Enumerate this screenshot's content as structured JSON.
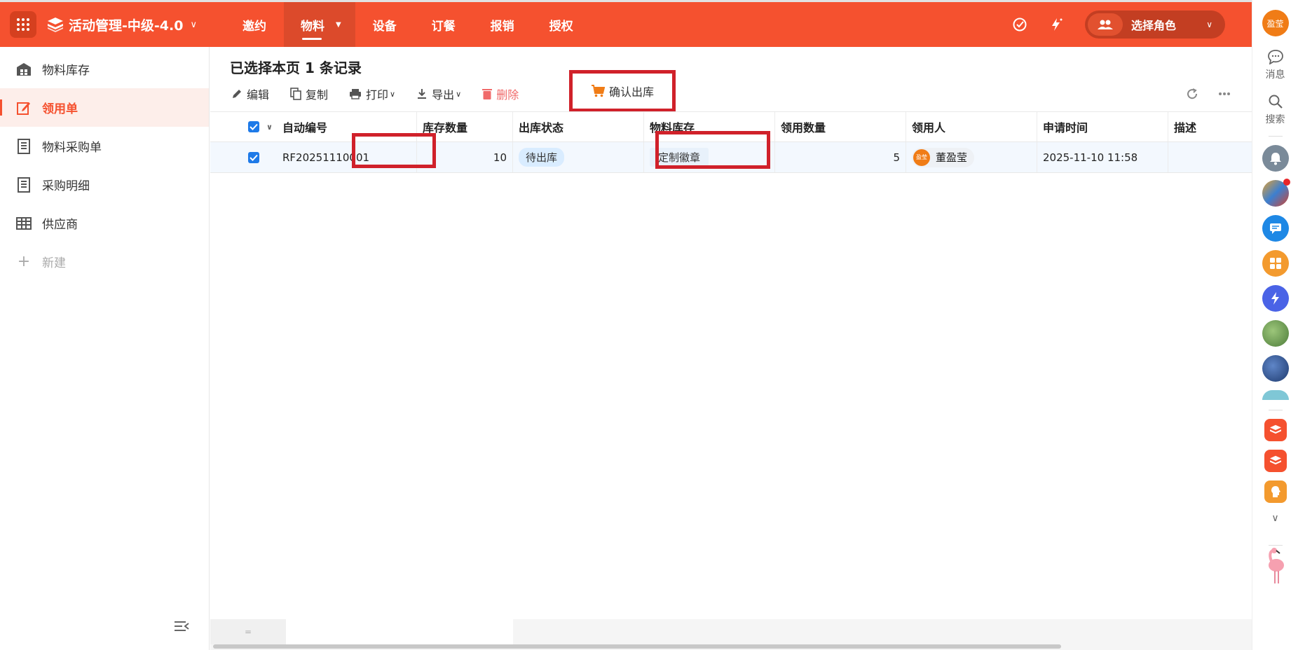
{
  "app": {
    "title": "活动管理-中级-4.0"
  },
  "nav": {
    "items": [
      {
        "label": "邀约"
      },
      {
        "label": "物料"
      },
      {
        "label": "设备"
      },
      {
        "label": "订餐"
      },
      {
        "label": "报销"
      },
      {
        "label": "授权"
      }
    ],
    "active": "物料"
  },
  "header": {
    "role_label": "选择角色"
  },
  "sidebar": {
    "items": [
      {
        "label": "物料库存",
        "icon": "warehouse-icon"
      },
      {
        "label": "领用单",
        "icon": "edit-form-icon"
      },
      {
        "label": "物料采购单",
        "icon": "document-list-icon"
      },
      {
        "label": "采购明细",
        "icon": "document-list-icon"
      },
      {
        "label": "供应商",
        "icon": "table-icon"
      }
    ],
    "new_label": "新建"
  },
  "main": {
    "selection_title": "已选择本页 1 条记录",
    "toolbar": {
      "edit": "编辑",
      "copy": "复制",
      "print": "打印",
      "export": "导出",
      "delete": "删除",
      "confirm_out": "确认出库"
    }
  },
  "table": {
    "columns": [
      "自动编号",
      "库存数量",
      "出库状态",
      "物料库存",
      "领用数量",
      "领用人",
      "申请时间",
      "描述"
    ],
    "rows": [
      {
        "code": "RF20251110001",
        "stock_qty": "10",
        "status": "待出库",
        "material": "定制徽章",
        "take_qty": "5",
        "person": "董盈莹",
        "person_avatar": "盈莹",
        "time": "2025-11-10 11:58",
        "desc": ""
      }
    ]
  },
  "footer": {
    "summary_hint": "="
  },
  "dock": {
    "avatar_text": "盈莹",
    "messages_label": "消息",
    "search_label": "搜索"
  },
  "colors": {
    "brand": "#f5512f",
    "highlight_box": "#d0212a",
    "checkbox": "#1e7ae8"
  }
}
